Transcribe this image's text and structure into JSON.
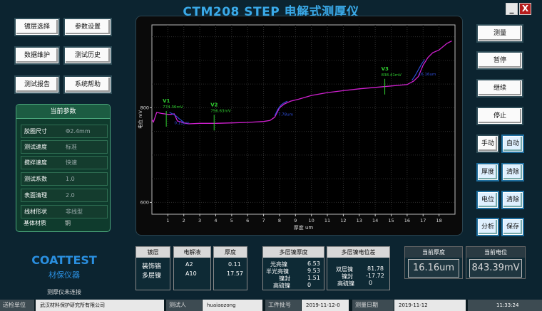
{
  "title": "CTM208 STEP 电解式测厚仪",
  "window": {
    "minimize": "_",
    "close": "X"
  },
  "left_buttons": [
    "镀层选择",
    "参数设置",
    "数据维护",
    "测试历史",
    "测试报告",
    "系统帮助"
  ],
  "params": {
    "title": "当前参数",
    "rows": [
      {
        "label": "胶圈尺寸",
        "value": "Φ2.4mm"
      },
      {
        "label": "测试速度",
        "value": "标准"
      },
      {
        "label": "搅拌速度",
        "value": "快速"
      },
      {
        "label": "测试系数",
        "value": "1.0"
      },
      {
        "label": "表面清理",
        "value": "2.0"
      },
      {
        "label": "线材形状",
        "value": "非线型"
      },
      {
        "label": "基体材质",
        "value": "铜"
      }
    ]
  },
  "logo": {
    "brand": "COATTEST",
    "sub": "材保仪器",
    "status": "测厚仪未连接"
  },
  "right_buttons": {
    "measure": "测量",
    "pause": "暂停",
    "resume": "继续",
    "stop": "停止",
    "manual": "手动",
    "auto": "自动",
    "thickness": "厚度",
    "clear1": "清除",
    "potential": "电位",
    "clear2": "清除",
    "analyze": "分析",
    "save": "保存"
  },
  "coating": {
    "head": "镀层",
    "lines": [
      "装饰铬",
      "多层镍"
    ]
  },
  "electrolyte": {
    "head": "电解液",
    "values": [
      "A2",
      "A10"
    ]
  },
  "thickness_col": {
    "head": "厚度",
    "values": [
      "0.11",
      "17.57"
    ]
  },
  "multi_thickness": {
    "head": "多层镍厚度",
    "rows": [
      {
        "label": "光亮镍",
        "value": "6.53"
      },
      {
        "label": "半光亮镍",
        "value": "9.53"
      },
      {
        "label": "镍封",
        "value": "1.51"
      },
      {
        "label": "高硫镍",
        "value": "0"
      }
    ]
  },
  "multi_potential": {
    "head": "多层镍电位差",
    "rows": [
      {
        "label": "双层镍",
        "value": "81.78"
      },
      {
        "label": "镍封",
        "value": "-17.72"
      },
      {
        "label": "高硫镍",
        "value": "0"
      }
    ]
  },
  "current_thickness": {
    "head": "当前厚度",
    "value": "16.16um"
  },
  "current_potential": {
    "head": "当前电位",
    "value": "843.39mV"
  },
  "statusbar": {
    "unit_label": "送检单位",
    "unit_value": "武汉材料保护研究所有限公司",
    "tester_label": "测试人",
    "tester_value": "huaiaozong",
    "batch_label": "工件批号",
    "batch_value": "2019-11-12-0",
    "date_label": "测量日期",
    "date_value": "2019-11-12",
    "time": "11:33:24"
  },
  "chart_data": {
    "type": "line",
    "xlabel": "厚度 um",
    "ylabel": "电位 mV",
    "xlim": [
      0,
      19
    ],
    "ylim": [
      575,
      975
    ],
    "x_ticks": [
      1,
      2,
      3,
      4,
      5,
      6,
      7,
      8,
      9,
      10,
      11,
      12,
      13,
      14,
      15,
      16,
      17,
      18
    ],
    "y_ticks": [
      600,
      800
    ],
    "grid": true,
    "series": [
      {
        "color": "#d020d0",
        "x": [
          0,
          0.1,
          0.3,
          0.6,
          1.0,
          1.2,
          1.4,
          1.6,
          1.8,
          2.0,
          2.3,
          3,
          4,
          5,
          6,
          7,
          7.4,
          7.7,
          8.0,
          8.3,
          8.7,
          9.2,
          10,
          11,
          12,
          13,
          14,
          15,
          16,
          16.4,
          16.7,
          17.0,
          17.3,
          17.6,
          18.0,
          18.5,
          18.8
        ],
        "y": [
          775,
          770,
          790,
          788,
          786,
          786,
          787,
          772,
          770,
          768,
          766,
          767,
          767,
          768,
          769,
          771,
          773,
          780,
          800,
          808,
          814,
          818,
          826,
          832,
          836,
          840,
          843,
          846,
          849,
          856,
          866,
          890,
          906,
          916,
          922,
          936,
          941
        ]
      },
      {
        "color": "#3050e0",
        "x": [
          1.1,
          1.3,
          1.5,
          1.7,
          1.9,
          2.0
        ],
        "y": [
          790,
          787,
          783,
          777,
          772,
          769
        ]
      },
      {
        "color": "#3050e0",
        "x": [
          7.7,
          7.9,
          8.1,
          8.3,
          8.5
        ],
        "y": [
          783,
          797,
          806,
          811,
          814
        ]
      },
      {
        "color": "#3050e0",
        "x": [
          16.3,
          16.5,
          16.7,
          16.9,
          17.1
        ],
        "y": [
          858,
          868,
          880,
          892,
          902
        ]
      }
    ],
    "annotations": [
      {
        "id": "V1",
        "value": "774.36mV",
        "x": 0.9,
        "y": 775,
        "color": "#30d030"
      },
      {
        "id": "V2",
        "value": "756.63mV",
        "x": 3.9,
        "y": 767,
        "color": "#30d030"
      },
      {
        "id": "V3",
        "value": "838.41mV",
        "x": 14.6,
        "y": 843,
        "color": "#30d030"
      },
      {
        "id": "T1",
        "value": "0.11um",
        "x": 1.5,
        "y": 777,
        "color": "#3050e0"
      },
      {
        "id": "T2",
        "value": "7.78um",
        "x": 8.0,
        "y": 795,
        "color": "#3050e0"
      },
      {
        "id": "T3",
        "value": "16.16um",
        "x": 16.8,
        "y": 880,
        "color": "#3050e0"
      }
    ]
  }
}
